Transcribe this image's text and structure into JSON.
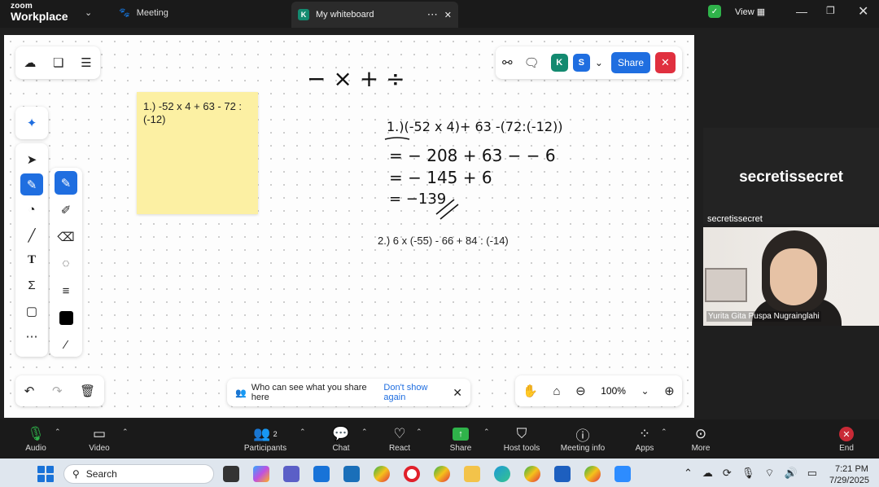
{
  "titlebar": {
    "app_top": "zoom",
    "app_name": "Workplace",
    "meeting_tab": "Meeting",
    "whiteboard_tab": {
      "badge": "K",
      "title": "My whiteboard"
    },
    "view_label": "View"
  },
  "whiteboard": {
    "sticky_note": "1.) -52 x 4 + 63 - 72 : (-12)",
    "handwriting": {
      "operators": "− × + ÷",
      "line1": "1.)(-52 x 4)+ 63 -(72:(-12))",
      "line2": "= − 208 + 63 − − 6",
      "line3": "= − 145 + 6",
      "line4": "= −139"
    },
    "problem2": "2.)  6 x (-55) - 66 + 84 : (-14)",
    "collaborators": [
      {
        "initial": "K",
        "color": "#138a70"
      },
      {
        "initial": "S",
        "color": "#1f6ee0"
      }
    ],
    "share_button": "Share",
    "privacy_banner": {
      "text": "Who can see what you share here",
      "link": "Don't show again"
    },
    "zoom_level": "100%"
  },
  "video": {
    "participant_name_large": "secretissecret",
    "participant_name_small": "secretissecret",
    "camera_label": "Yurita Gita Puspa Nugrainglahi"
  },
  "meeting_toolbar": {
    "audio": "Audio",
    "video": "Video",
    "participants": "Participants",
    "participants_count": "2",
    "chat": "Chat",
    "react": "React",
    "share": "Share",
    "host_tools": "Host tools",
    "meeting_info": "Meeting info",
    "apps": "Apps",
    "more": "More",
    "end": "End"
  },
  "taskbar": {
    "search_placeholder": "Search",
    "time": "7:21 PM",
    "date": "7/29/2025"
  }
}
